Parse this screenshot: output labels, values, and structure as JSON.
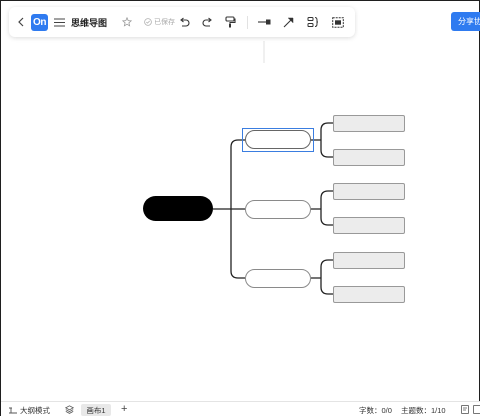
{
  "toolbar": {
    "logo_text": "On",
    "doc_title": "思维导图",
    "saved_status": "已保存",
    "icons": [
      "back-icon",
      "menu-icon",
      "star-icon",
      "check-circle-icon",
      "undo-icon",
      "redo-icon",
      "format-painter-icon",
      "connector-icon",
      "arrow-icon",
      "summary-icon",
      "frame-icon"
    ]
  },
  "share_button_label": "分享协",
  "mindmap": {
    "root_color": "#000000",
    "selection_color": "#3a7de0",
    "branch_count": 3,
    "leaves_per_branch": 2
  },
  "statusbar": {
    "outline_mode_label": "大纲模式",
    "canvas_tab_label": "画布1",
    "word_count": "字数：0/0",
    "topic_count": "主题数：1/10"
  },
  "colors": {
    "accent": "#2f7bf0",
    "node_border": "#8a8a8a",
    "leaf_fill": "#ececec"
  }
}
